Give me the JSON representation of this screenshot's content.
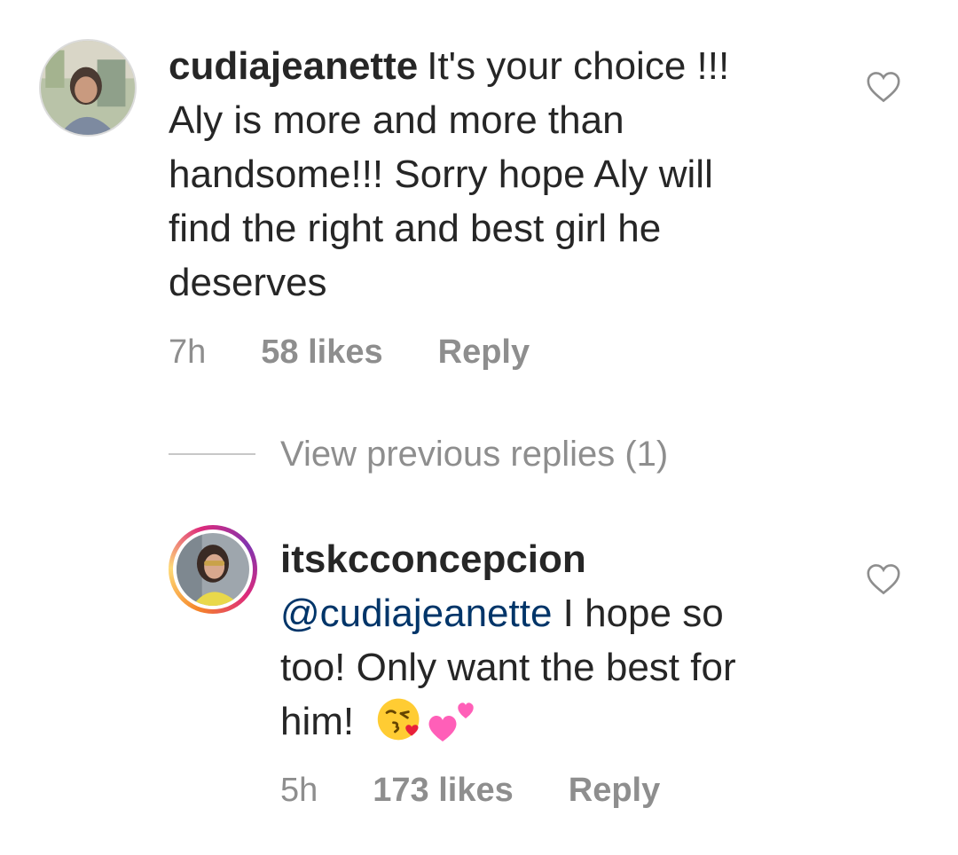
{
  "comment1": {
    "avatar": "profile-photo",
    "username": "cudiajeanette",
    "lines": [
      "It's your choice !!!",
      "Aly is more and more than",
      "handsome!!! Sorry hope Aly will",
      "find the right  and best girl he",
      "deserves"
    ],
    "time": "7h",
    "likes": "58 likes",
    "reply": "Reply",
    "like_icon": "heart-outline-icon"
  },
  "view_previous": "View previous replies (1)",
  "comment2": {
    "avatar": "profile-photo-story-ring",
    "username": "itskcconcepcion",
    "mention": "@cudiajeanette",
    "lines": [
      " I hope so",
      "too! Only want the best for",
      "him! "
    ],
    "emojis": [
      "face-blowing-kiss-emoji",
      "two-hearts-emoji"
    ],
    "time": "5h",
    "likes": "173 likes",
    "reply": "Reply",
    "like_icon": "heart-outline-icon"
  },
  "colors": {
    "text": "#262626",
    "muted": "#8e8e8e",
    "mention": "#003569",
    "divider": "#c7c7c7"
  }
}
